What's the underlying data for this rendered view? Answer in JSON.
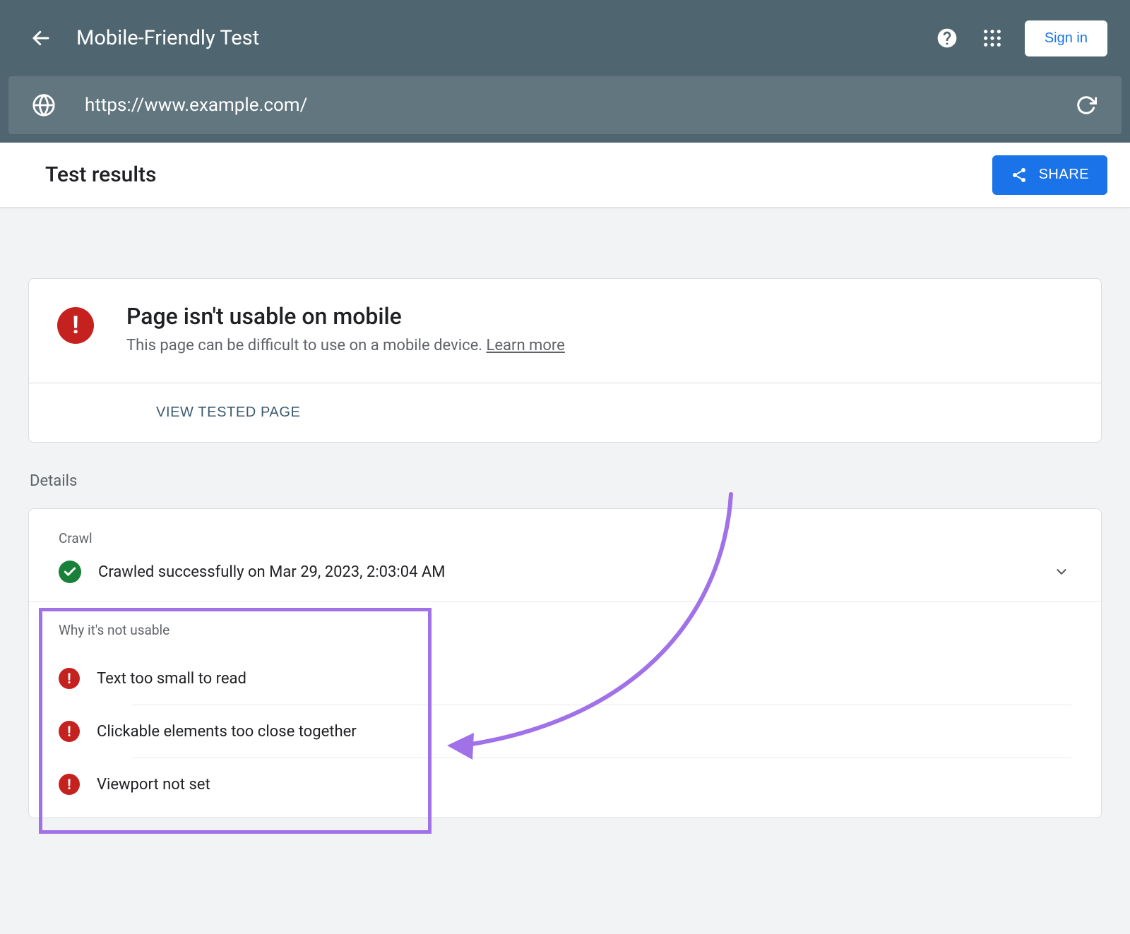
{
  "header": {
    "title": "Mobile-Friendly Test",
    "signin_label": "Sign in"
  },
  "urlbar": {
    "url": "https://www.example.com/"
  },
  "subheader": {
    "title": "Test results",
    "share_label": "SHARE"
  },
  "status": {
    "title": "Page isn't usable on mobile",
    "description": "This page can be difficult to use on a mobile device. ",
    "learn_more": "Learn more",
    "view_tested_label": "VIEW TESTED PAGE"
  },
  "details": {
    "section_label": "Details",
    "crawl_label": "Crawl",
    "crawl_status": "Crawled successfully on Mar 29, 2023, 2:03:04 AM",
    "issues_label": "Why it's not usable",
    "issues": [
      "Text too small to read",
      "Clickable elements too close together",
      "Viewport not set"
    ]
  }
}
